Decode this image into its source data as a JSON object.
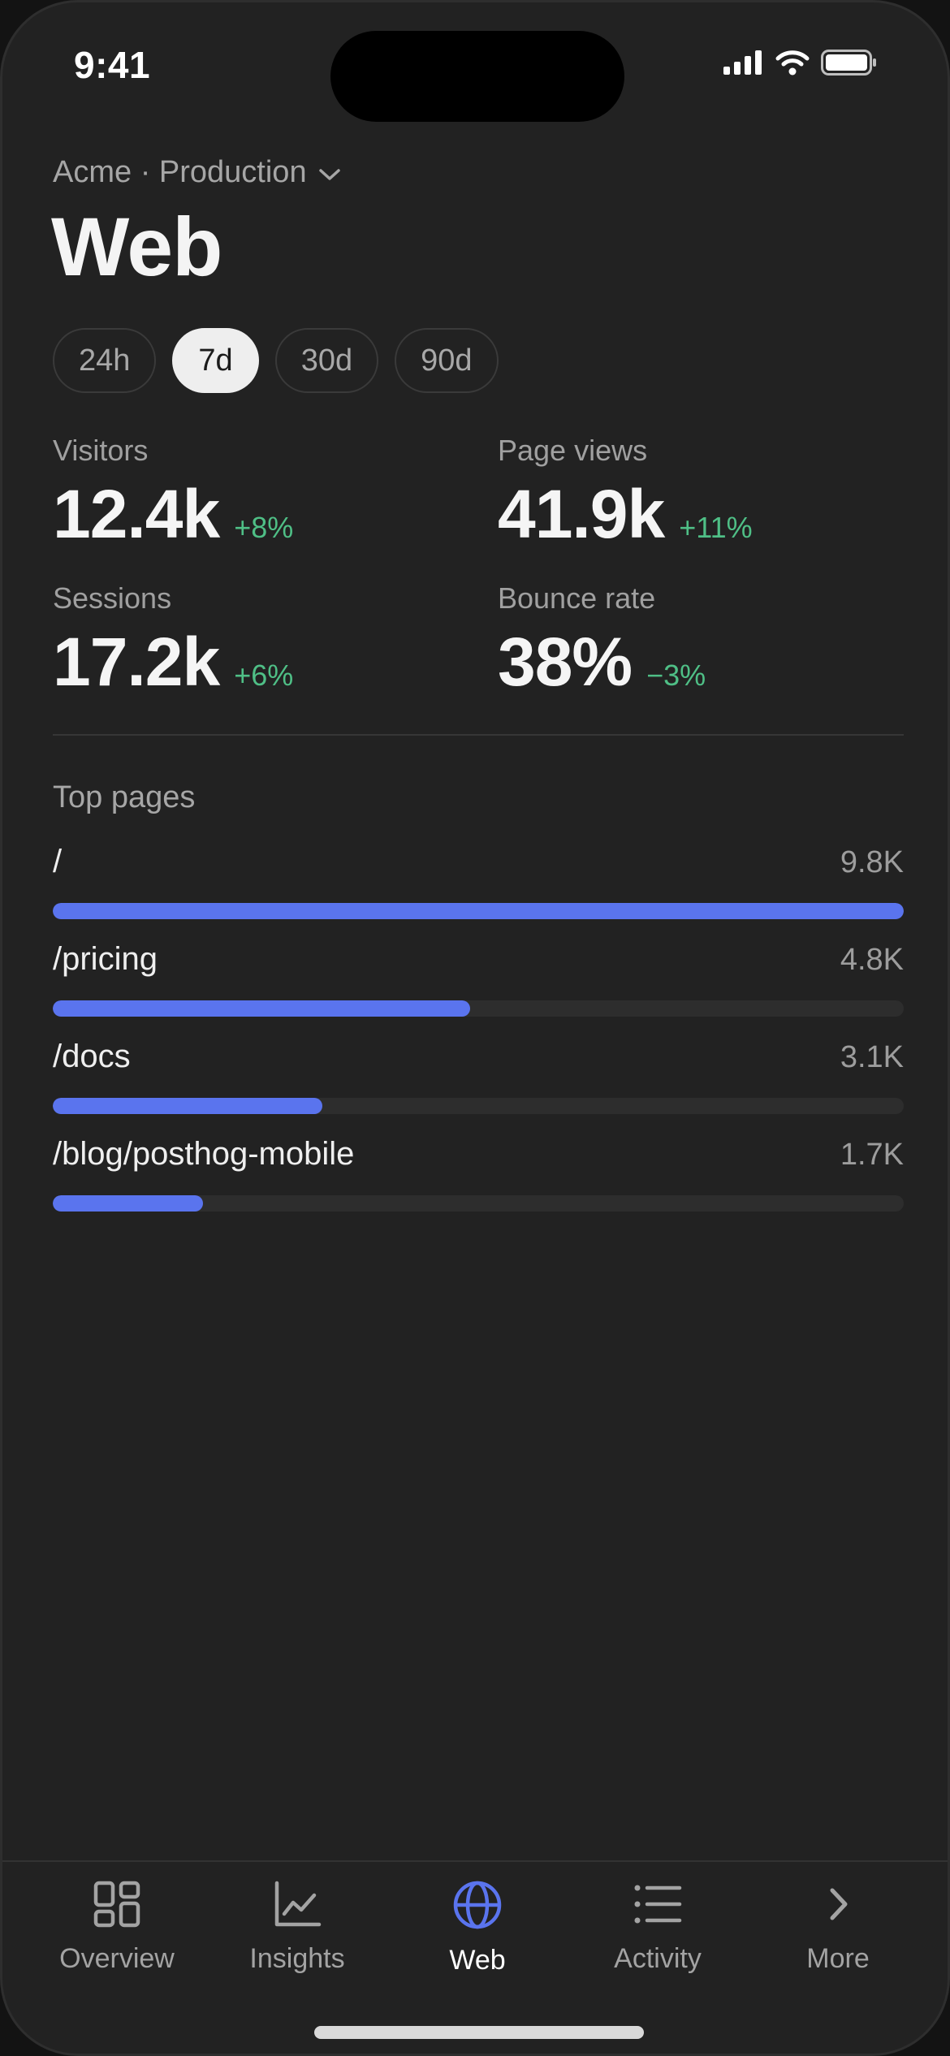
{
  "status_bar": {
    "time": "9:41",
    "icons": [
      "cellular-signal-icon",
      "wifi-icon",
      "battery-icon"
    ]
  },
  "header": {
    "project": "Acme · Production",
    "project_dropdown_icon": "chevron-down-icon",
    "title": "Web"
  },
  "ranges": {
    "options": [
      "24h",
      "7d",
      "30d",
      "90d"
    ],
    "selected": "7d"
  },
  "stats": [
    {
      "label": "Visitors",
      "value": "12.4k",
      "change": "+8%"
    },
    {
      "label": "Page views",
      "value": "41.9k",
      "change": "+11%"
    },
    {
      "label": "Sessions",
      "value": "17.2k",
      "change": "+6%"
    },
    {
      "label": "Bounce rate",
      "value": "38%",
      "change": "−3%"
    }
  ],
  "top_pages": {
    "title": "Top pages",
    "rows": [
      {
        "path": "/",
        "count": "9.8K",
        "fraction": 1.0
      },
      {
        "path": "/pricing",
        "count": "4.8K",
        "fraction": 0.49
      },
      {
        "path": "/docs",
        "count": "3.1K",
        "fraction": 0.317
      },
      {
        "path": "/blog/posthog-mobile",
        "count": "1.7K",
        "fraction": 0.177
      }
    ]
  },
  "tabbar": {
    "tabs": [
      {
        "label": "Overview",
        "icon": "grid-icon"
      },
      {
        "label": "Insights",
        "icon": "line-chart-icon"
      },
      {
        "label": "Web",
        "icon": "globe-icon"
      },
      {
        "label": "Activity",
        "icon": "list-icon"
      },
      {
        "label": "More",
        "icon": "chevron-right-icon"
      }
    ],
    "active": "Web"
  },
  "colors": {
    "accent": "#5a74ee",
    "positive": "#4fbf86",
    "background": "#222222"
  }
}
